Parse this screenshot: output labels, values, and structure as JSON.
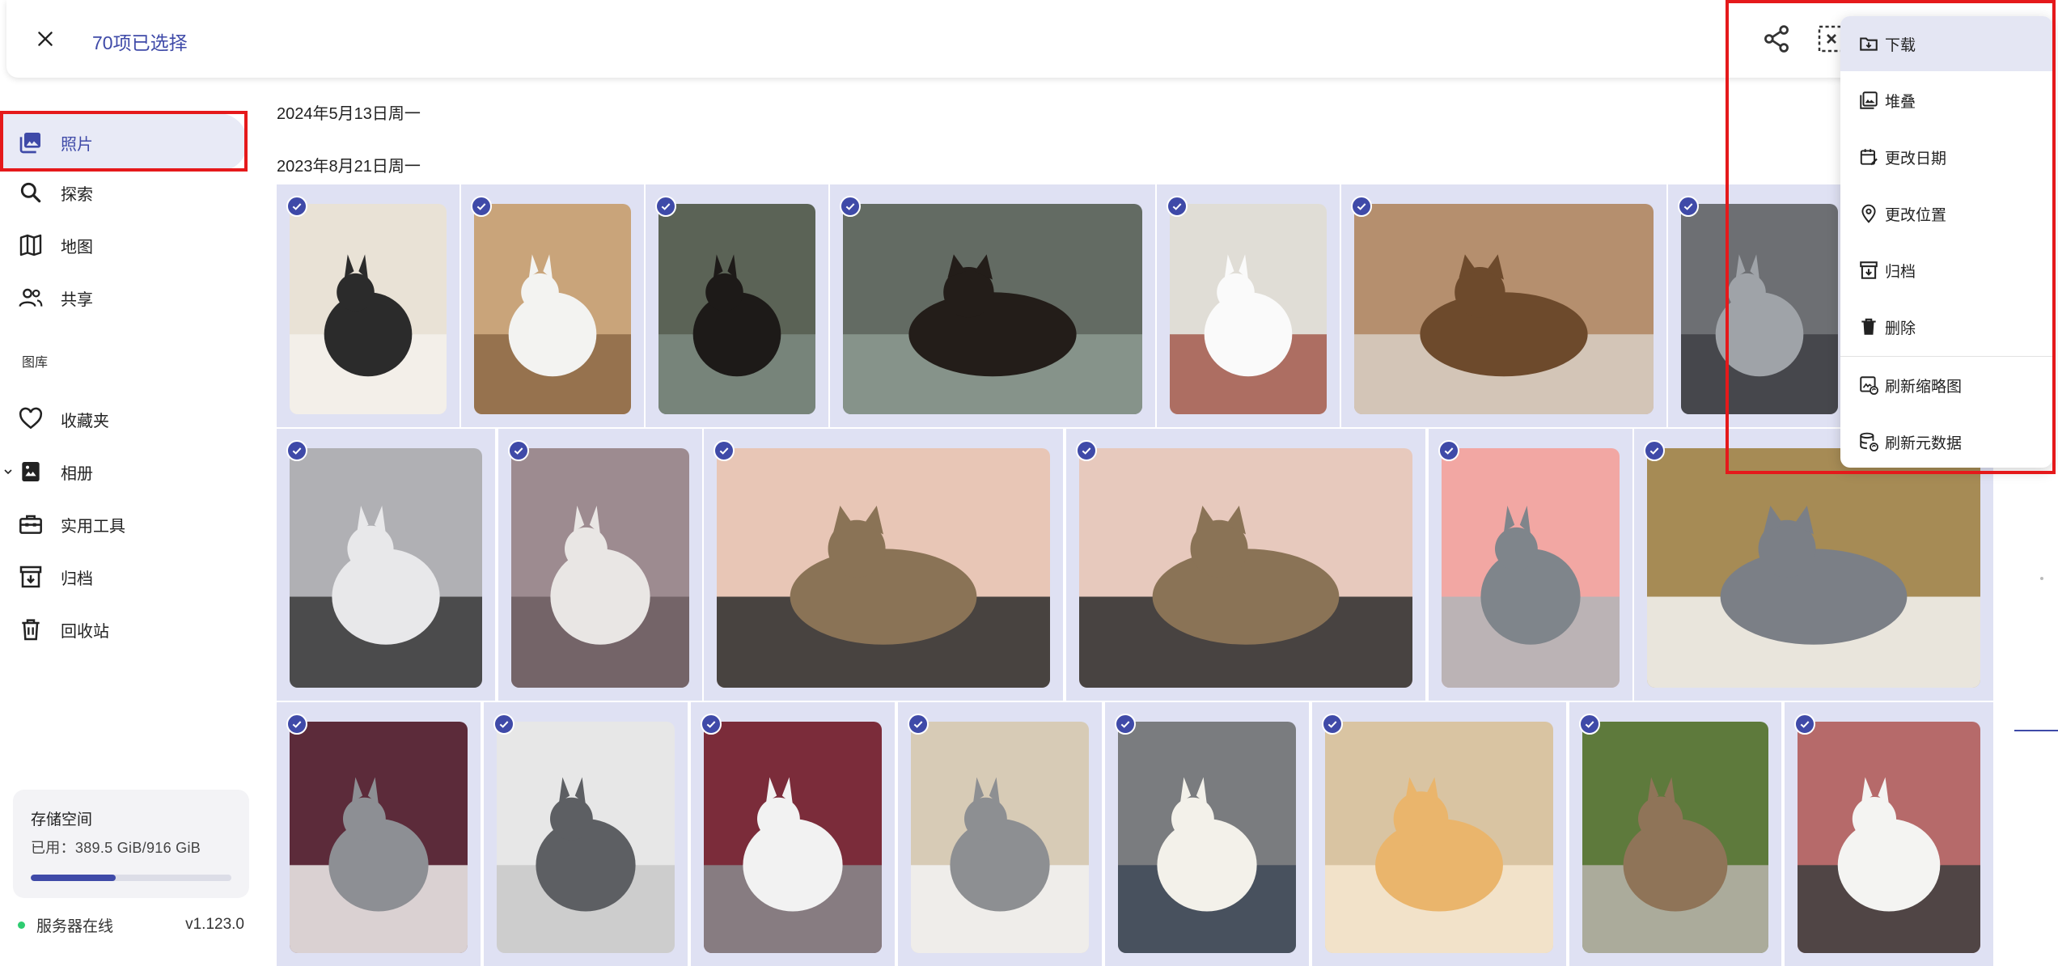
{
  "topbar": {
    "selection_title": "70项已选择"
  },
  "sidebar": {
    "items": [
      {
        "label": "照片",
        "icon": "photos-icon"
      },
      {
        "label": "探索",
        "icon": "search-icon"
      },
      {
        "label": "地图",
        "icon": "map-icon"
      },
      {
        "label": "共享",
        "icon": "people-icon"
      }
    ],
    "library_header": "图库",
    "library_items": [
      {
        "label": "收藏夹",
        "icon": "heart-icon"
      },
      {
        "label": "相册",
        "icon": "album-icon"
      },
      {
        "label": "实用工具",
        "icon": "toolbox-icon"
      },
      {
        "label": "归档",
        "icon": "archive-icon"
      },
      {
        "label": "回收站",
        "icon": "trash-icon"
      }
    ],
    "storage": {
      "title": "存储空间",
      "used_text": "已用：389.5 GiB/916 GiB",
      "used_fraction": 0.425
    },
    "status": {
      "text": "服务器在线",
      "version": "v1.123.0"
    }
  },
  "main": {
    "date_headers": [
      "2024年5月13日周一",
      "2023年8月21日周一"
    ]
  },
  "menu": {
    "items": [
      {
        "label": "下载",
        "icon": "download-icon"
      },
      {
        "label": "堆叠",
        "icon": "stack-icon"
      },
      {
        "label": "更改日期",
        "icon": "calendar-edit-icon"
      },
      {
        "label": "更改位置",
        "icon": "location-icon"
      },
      {
        "label": "归档",
        "icon": "archive-icon"
      },
      {
        "label": "删除",
        "icon": "trash-icon"
      },
      {
        "label": "刷新缩略图",
        "icon": "refresh-thumbnail-icon"
      },
      {
        "label": "刷新元数据",
        "icon": "refresh-metadata-icon"
      }
    ]
  },
  "colors": {
    "accent": "#3f4aa8",
    "selected_tile": "#dfe1f3",
    "annotation_red": "#e5191b",
    "online_green": "#2ecc71"
  }
}
